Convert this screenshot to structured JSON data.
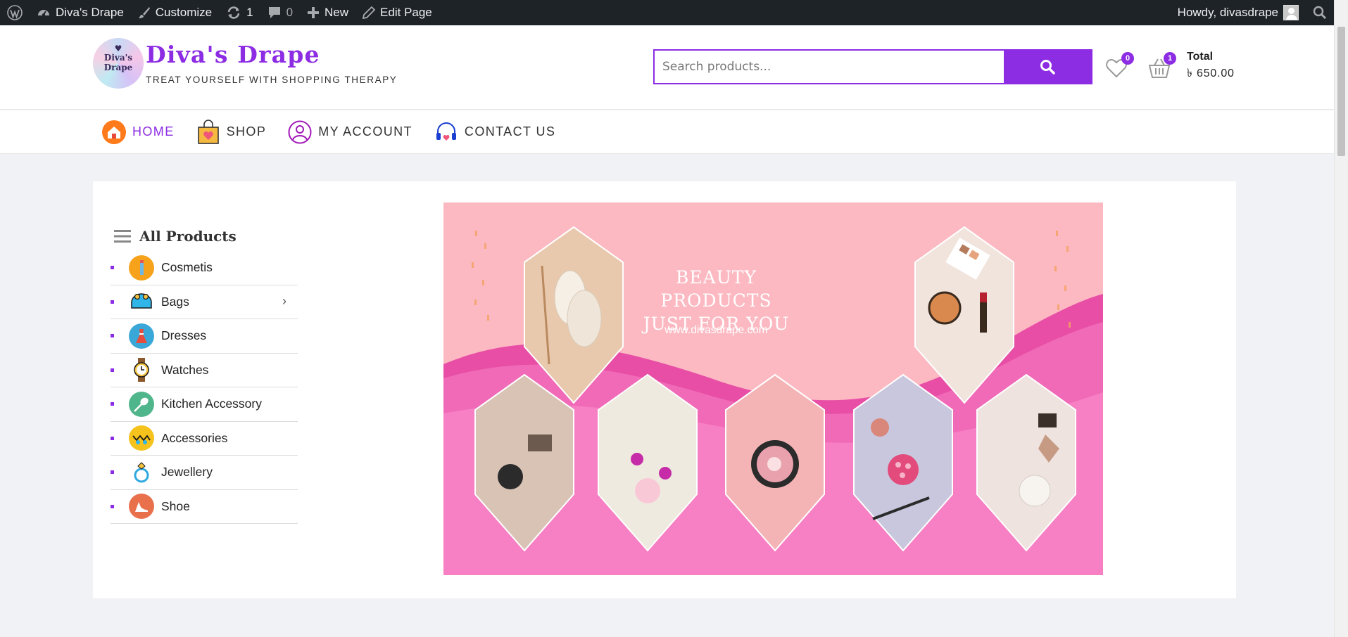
{
  "admin_bar": {
    "site_name": "Diva's Drape",
    "customize": "Customize",
    "updates_count": "1",
    "comments_count": "0",
    "new_label": "New",
    "edit_label": "Edit Page",
    "howdy": "Howdy, divasdrape"
  },
  "header": {
    "logo_text": "Diva's Drape",
    "site_title": "Diva's Drape",
    "tagline": "TREAT YOURSELF WITH SHOPPING THERAPY",
    "search_placeholder": "Search products...",
    "wishlist_count": "0",
    "cart_count": "1",
    "total_label": "Total",
    "total_amount": "৳ 650.00"
  },
  "nav": {
    "items": [
      {
        "label": "HOME",
        "icon": "home-icon"
      },
      {
        "label": "SHOP",
        "icon": "shopping-bag-icon"
      },
      {
        "label": "MY ACCOUNT",
        "icon": "user-icon"
      },
      {
        "label": "CONTACT US",
        "icon": "headset-icon"
      }
    ]
  },
  "sidebar": {
    "title": "All Products",
    "categories": [
      {
        "label": "Cosmetis",
        "icon": "cosmetics-icon"
      },
      {
        "label": "Bags",
        "icon": "bag-icon",
        "has_children": true
      },
      {
        "label": "Dresses",
        "icon": "dress-icon"
      },
      {
        "label": "Watches",
        "icon": "watch-icon"
      },
      {
        "label": "Kitchen Accessory",
        "icon": "kitchen-icon"
      },
      {
        "label": "Accessories",
        "icon": "accessories-icon"
      },
      {
        "label": "Jewellery",
        "icon": "ring-icon"
      },
      {
        "label": "Shoe",
        "icon": "shoe-icon"
      }
    ]
  },
  "banner": {
    "title_line1": "BEAUTY PRODUCTS",
    "title_line2": "JUST FOR YOU",
    "url": "www.divasdrape.com"
  },
  "colors": {
    "accent": "#8c2ce3",
    "admin_bar": "#1d2327",
    "banner_pink": "#fcb9c2",
    "banner_magenta": "#f06ab7"
  }
}
